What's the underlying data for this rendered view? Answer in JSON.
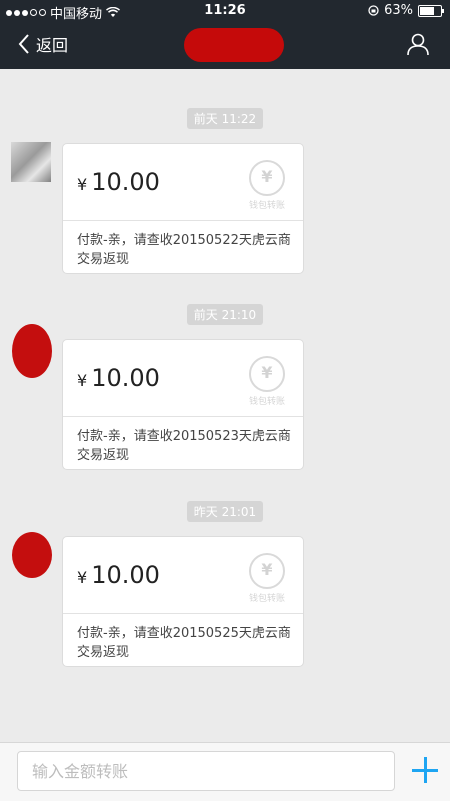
{
  "status_bar": {
    "carrier": "中国移动",
    "time": "11:26",
    "battery": "63%",
    "battery_level": 0.63
  },
  "nav": {
    "back_label": "返回",
    "icons": {
      "back": "chevron-left-icon",
      "profile": "user-icon"
    }
  },
  "messages": [
    {
      "timestamp": "前天 11:22",
      "currency": "¥",
      "amount": "10.00",
      "stamp_label": "钱包转账",
      "note": "付款-亲，请查收20150522天虎云商交易返现"
    },
    {
      "timestamp": "前天 21:10",
      "currency": "¥",
      "amount": "10.00",
      "stamp_label": "钱包转账",
      "note": "付款-亲，请查收20150523天虎云商交易返现"
    },
    {
      "timestamp": "昨天 21:01",
      "currency": "¥",
      "amount": "10.00",
      "stamp_label": "钱包转账",
      "note": "付款-亲，请查收20150525天虎云商交易返现"
    }
  ],
  "input_bar": {
    "placeholder": "输入金额转账",
    "accent_color": "#1ea5f2"
  }
}
